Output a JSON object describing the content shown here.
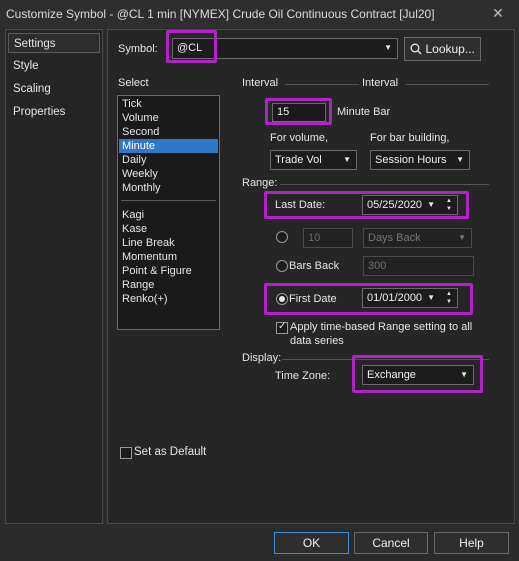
{
  "window": {
    "title": "Customize Symbol - @CL 1 min [NYMEX] Crude Oil Continuous Contract [Jul20]",
    "close_glyph": "✕"
  },
  "nav": {
    "items": [
      "Settings",
      "Style",
      "Scaling",
      "Properties"
    ],
    "active": "Settings"
  },
  "symbol": {
    "label": "Symbol:",
    "value": "@CL",
    "lookup_label": "Lookup..."
  },
  "select": {
    "label": "Select",
    "group1": [
      "Tick",
      "Volume",
      "Second",
      "Minute",
      "Daily",
      "Weekly",
      "Monthly"
    ],
    "group2": [
      "Kagi",
      "Kase",
      "Line Break",
      "Momentum",
      "Point & Figure",
      "Range",
      "Renko(+)"
    ],
    "selected": "Minute"
  },
  "interval": {
    "header_left": "Interval",
    "header_right": "Interval",
    "value": "15",
    "unit": "Minute Bar",
    "for_volume_label": "For volume,",
    "for_bar_label": "For bar building,",
    "volume_value": "Trade Vol",
    "bar_value": "Session Hours"
  },
  "range": {
    "label": "Range:",
    "last_date_label": "Last Date:",
    "last_date_value": "05/25/2020",
    "days_back_count": "10",
    "days_back_value": "Days Back",
    "bars_back_label": "Bars Back",
    "bars_back_value": "300",
    "first_date_label": "First Date",
    "first_date_value": "01/01/2000",
    "apply_label_1": "Apply time-based Range setting to all",
    "apply_label_2": "data series"
  },
  "display": {
    "label": "Display:",
    "timezone_label": "Time Zone:",
    "timezone_value": "Exchange"
  },
  "defaults": {
    "set_default_label": "Set as Default"
  },
  "buttons": {
    "ok": "OK",
    "cancel": "Cancel",
    "help": "Help"
  },
  "colors": {
    "highlight": "#b321c9",
    "selection": "#2f78c8",
    "default_button_border": "#3c8fd9"
  }
}
